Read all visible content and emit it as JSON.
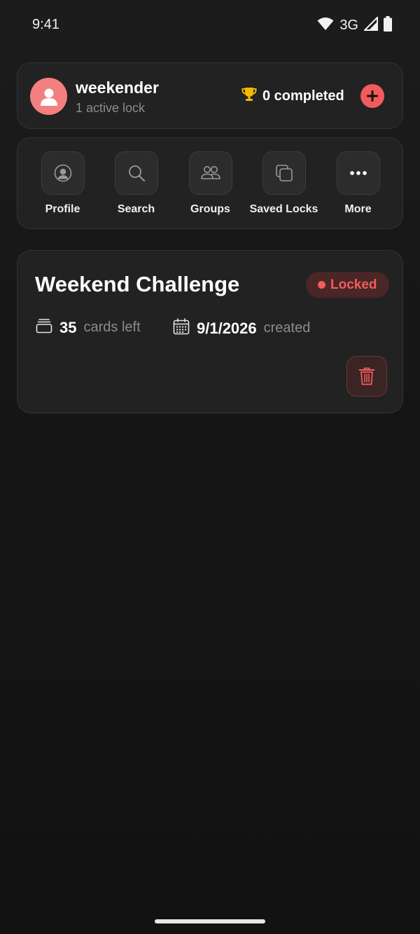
{
  "status_bar": {
    "time": "9:41",
    "network": "3G"
  },
  "header": {
    "username": "weekender",
    "subtitle": "1 active lock",
    "completed_label": "0 completed"
  },
  "actions": [
    {
      "label": "Profile",
      "icon": "profile-icon"
    },
    {
      "label": "Search",
      "icon": "search-icon"
    },
    {
      "label": "Groups",
      "icon": "groups-icon"
    },
    {
      "label": "Saved Locks",
      "icon": "saved-locks-icon"
    },
    {
      "label": "More",
      "icon": "more-icon"
    }
  ],
  "lock": {
    "title": "Weekend Challenge",
    "status": "Locked",
    "cards_value": "35",
    "cards_label": "cards left",
    "date_value": "9/1/2026",
    "date_label": "created"
  },
  "colors": {
    "accent": "#f25c5c",
    "avatar": "#f28080",
    "trophy": "#f5b800",
    "background": "#151515",
    "card": "#222222"
  }
}
